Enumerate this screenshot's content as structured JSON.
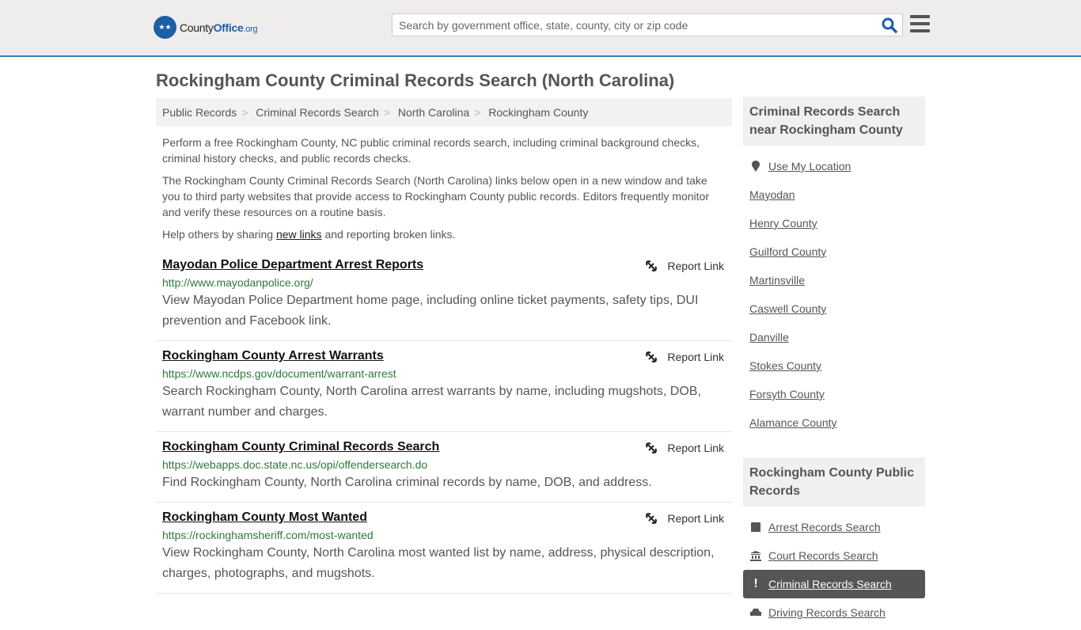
{
  "header": {
    "logo_main": "County",
    "logo_bold": "Office",
    "logo_suffix": ".org",
    "search_placeholder": "Search by government office, state, county, city or zip code",
    "search_icon": "search-icon",
    "menu_icon": "hamburger-menu-icon"
  },
  "page_title": "Rockingham County Criminal Records Search (North Carolina)",
  "breadcrumb": [
    "Public Records",
    "Criminal Records Search",
    "North Carolina",
    "Rockingham County"
  ],
  "intro": {
    "p1": "Perform a free Rockingham County, NC public criminal records search, including criminal background checks, criminal history checks, and public records checks.",
    "p2": "The Rockingham County Criminal Records Search (North Carolina) links below open in a new window and take you to third party websites that provide access to Rockingham County public records. Editors frequently monitor and verify these resources on a routine basis.",
    "p3_before": "Help others by sharing ",
    "p3_link": "new links",
    "p3_after": " and reporting broken links."
  },
  "report_label": "Report Link",
  "listings": [
    {
      "title": "Mayodan Police Department Arrest Reports",
      "url": "http://www.mayodanpolice.org/",
      "desc": "View Mayodan Police Department home page, including online ticket payments, safety tips, DUI prevention and Facebook link."
    },
    {
      "title": "Rockingham County Arrest Warrants",
      "url": "https://www.ncdps.gov/document/warrant-arrest",
      "desc": "Search Rockingham County, North Carolina arrest warrants by name, including mugshots, DOB, warrant number and charges."
    },
    {
      "title": "Rockingham County Criminal Records Search",
      "url": "https://webapps.doc.state.nc.us/opi/offendersearch.do",
      "desc": "Find Rockingham County, North Carolina criminal records by name, DOB, and address."
    },
    {
      "title": "Rockingham County Most Wanted",
      "url": "https://rockinghamsheriff.com/most-wanted",
      "desc": "View Rockingham County, North Carolina most wanted list by name, address, physical description, charges, photographs, and mugshots."
    }
  ],
  "sidebar": {
    "nearby_title": "Criminal Records Search near Rockingham County",
    "use_location": "Use My Location",
    "nearby": [
      "Mayodan",
      "Henry County",
      "Guilford County",
      "Martinsville",
      "Caswell County",
      "Danville",
      "Stokes County",
      "Forsyth County",
      "Alamance County"
    ],
    "public_title": "Rockingham County Public Records",
    "public_items": [
      {
        "label": "Arrest Records Search",
        "icon": "square-icon"
      },
      {
        "label": "Court Records Search",
        "icon": "courthouse-icon"
      },
      {
        "label": "Criminal Records Search",
        "icon": "exclamation-icon",
        "active": true
      },
      {
        "label": "Driving Records Search",
        "icon": "car-icon"
      }
    ]
  }
}
